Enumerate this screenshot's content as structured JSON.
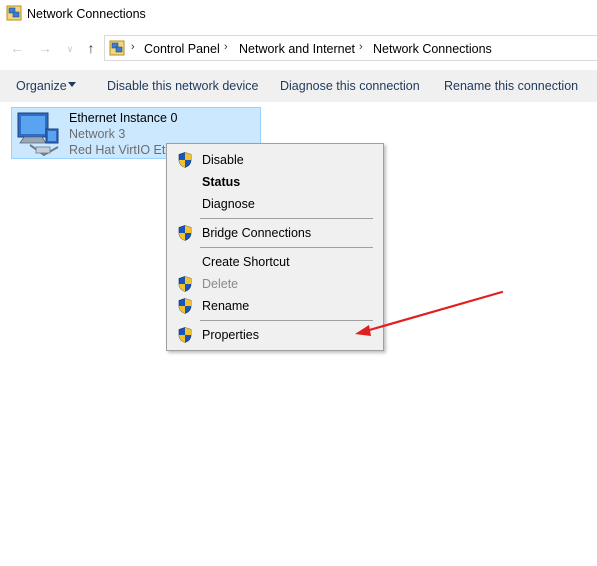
{
  "window": {
    "title": "Network Connections"
  },
  "navigation": {
    "breadcrumbs": [
      "Control Panel",
      "Network and Internet",
      "Network Connections"
    ]
  },
  "toolbar": {
    "organize_label": "Organize",
    "disable_label": "Disable this network device",
    "diagnose_label": "Diagnose this connection",
    "rename_label": "Rename this connection"
  },
  "connection": {
    "name": "Ethernet Instance 0",
    "network": "Network 3",
    "adapter": "Red Hat VirtIO Ethe"
  },
  "context_menu": {
    "items": [
      {
        "label": "Disable",
        "icon": "uac-shield-icon"
      },
      {
        "label": "Status"
      },
      {
        "label": "Diagnose"
      },
      {
        "label": "Bridge Connections",
        "icon": "uac-shield-icon"
      },
      {
        "label": "Create Shortcut"
      },
      {
        "label": "Delete",
        "icon": "uac-shield-icon"
      },
      {
        "label": "Rename",
        "icon": "uac-shield-icon"
      },
      {
        "label": "Properties",
        "icon": "uac-shield-icon"
      }
    ]
  },
  "colors": {
    "selection_fill": "#cce8ff",
    "menu_background": "#f0f0f0",
    "annotation_arrow": "#e02020"
  }
}
